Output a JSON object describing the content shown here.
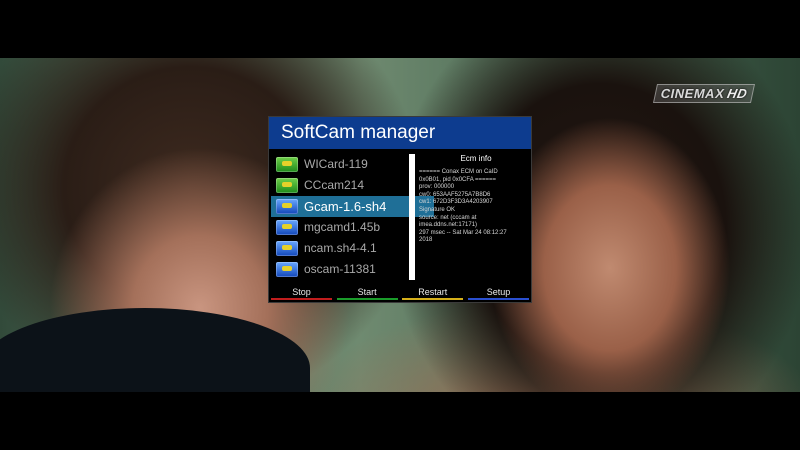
{
  "overlay": {
    "channel_logo": "CINEMAX",
    "channel_logo_hd": "HD"
  },
  "panel": {
    "title": "SoftCam manager",
    "cams": [
      {
        "label": "WICard-119",
        "icon": "green-cam-icon",
        "selected": false
      },
      {
        "label": "CCcam214",
        "icon": "green-cam-icon",
        "selected": false
      },
      {
        "label": "Gcam-1.6-sh4",
        "icon": "blue-cam-icon",
        "selected": true
      },
      {
        "label": "mgcamd1.45b",
        "icon": "blue-cam-icon",
        "selected": false
      },
      {
        "label": "ncam.sh4-4.1",
        "icon": "blue-cam-icon",
        "selected": false
      },
      {
        "label": "oscam-11381",
        "icon": "blue-cam-icon",
        "selected": false
      }
    ],
    "ecm_title": "Ecm info",
    "ecm_text": "====== Conax ECM on CaID\n0x0B01, pid 0x0CFA ======\nprov: 000000\ncw0: 653AAF5275A7B8D6\ncw1: 672D3F3D3A4203907\nSignature OK\nsource: net (cccam at\nimea.ddns.net:17171)\n297 msec -- Sat Mar 24 08:12:27\n2018",
    "buttons": [
      {
        "label": "Stop",
        "color": "#c11d1d"
      },
      {
        "label": "Start",
        "color": "#1a9c2a"
      },
      {
        "label": "Restart",
        "color": "#d6b01a"
      },
      {
        "label": "Setup",
        "color": "#2a4fd0"
      }
    ]
  }
}
